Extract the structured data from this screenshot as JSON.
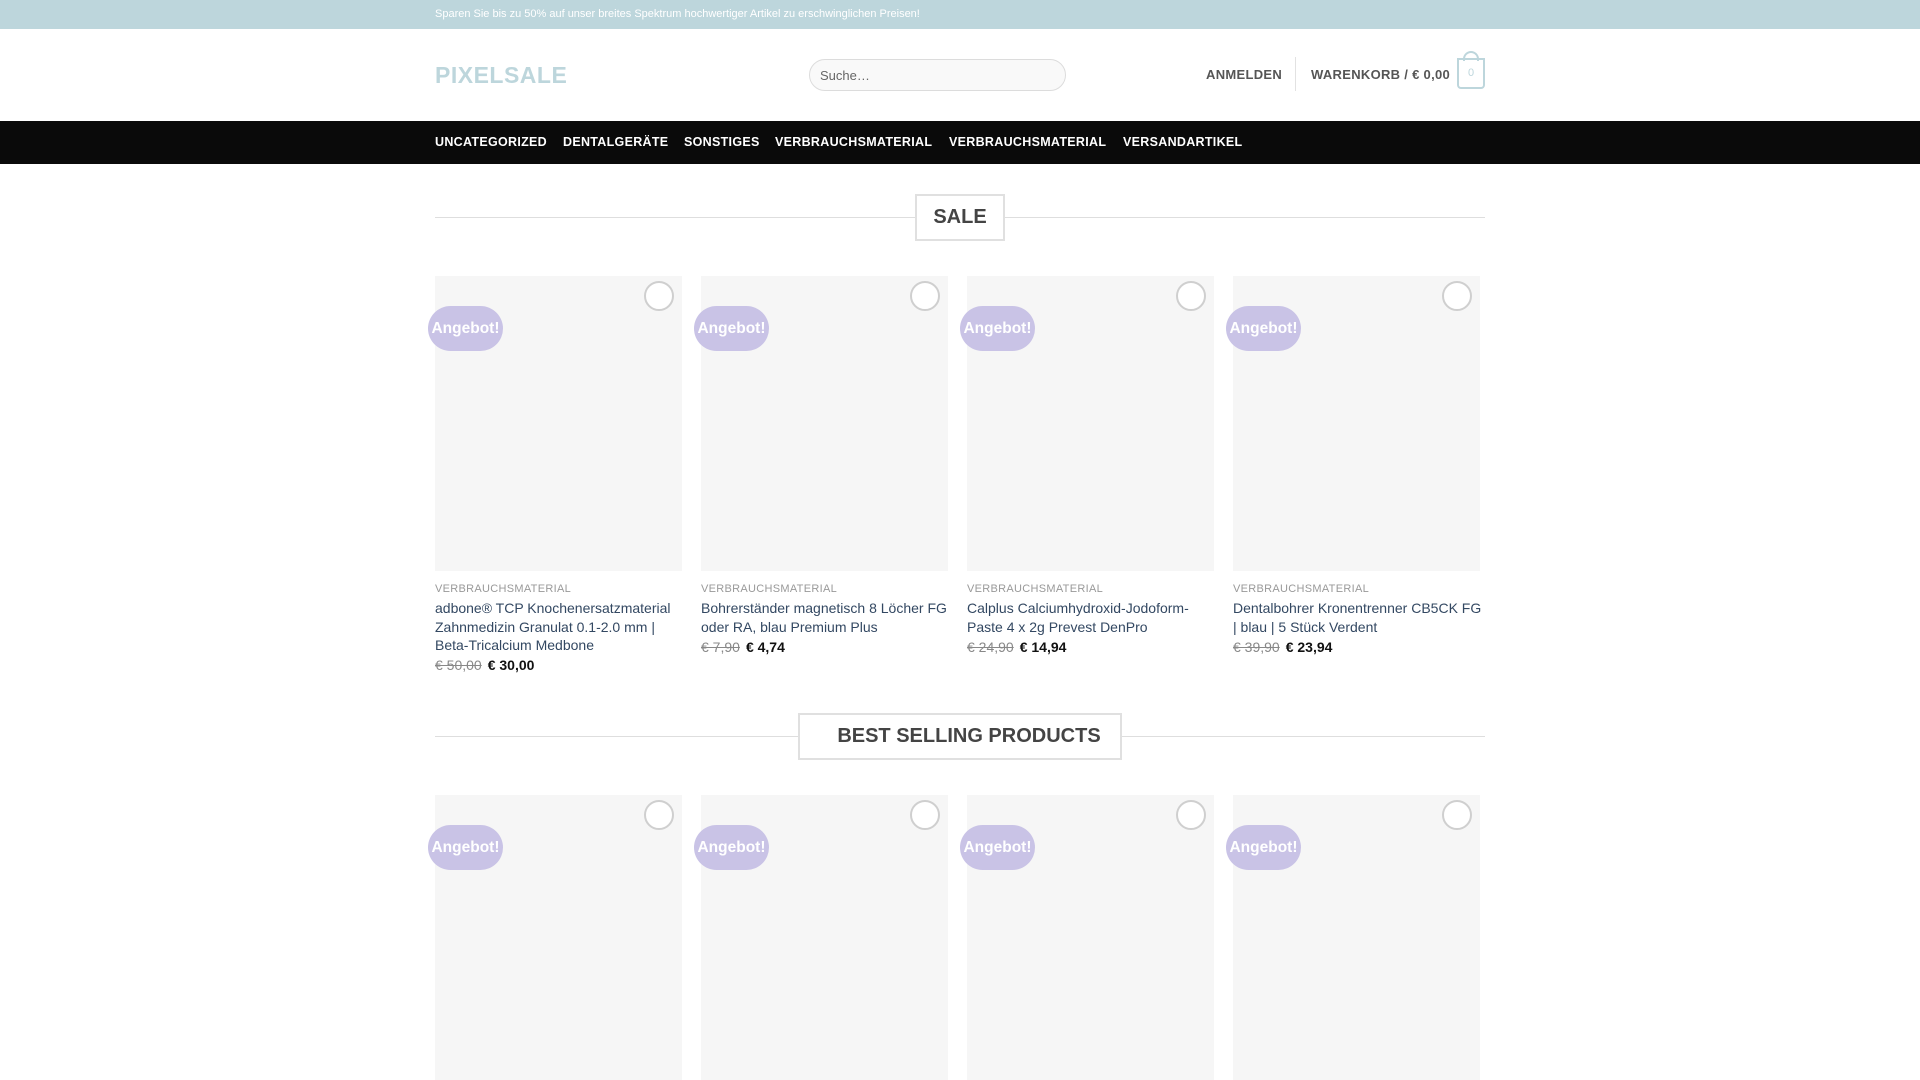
{
  "topbar": {
    "text": "Sparen Sie bis zu 50% auf unser breites Spektrum hochwertiger Artikel zu erschwinglichen Preisen!"
  },
  "header": {
    "logo": "PIXELSALE",
    "search_placeholder": "Suche…",
    "login": "ANMELDEN",
    "cart": "WARENKORB / € 0,00",
    "cart_count": "0"
  },
  "nav": [
    "UNCATEGORIZED",
    "DENTALGERÄTE",
    "SONSTIGES",
    "VERBRAUCHSMATERIAL",
    "VERBRAUCHSMATERIAL",
    "VERSANDARTIKEL"
  ],
  "sections": {
    "sale": {
      "title": "SALE"
    },
    "best": {
      "title": "BEST SELLING PRODUCTS"
    }
  },
  "badge_label": "Angebot!",
  "sale_products": [
    {
      "category": "VERBRAUCHSMATERIAL",
      "title": "adbone® TCP Knochenersatzmaterial Zahnmedizin Granulat 0.1-2.0 mm | Beta-Tricalcium Medbone",
      "old_price": "€ 50,00",
      "price": "€ 30,00"
    },
    {
      "category": "VERBRAUCHSMATERIAL",
      "title": "Bohrerständer magnetisch 8 Löcher FG oder RA, blau Premium Plus",
      "old_price": "€ 7,90",
      "price": "€ 4,74"
    },
    {
      "category": "VERBRAUCHSMATERIAL",
      "title": "Calplus Calciumhydroxid-Jodoform-Paste 4 x 2g Prevest DenPro",
      "old_price": "€ 24,90",
      "price": "€ 14,94"
    },
    {
      "category": "VERBRAUCHSMATERIAL",
      "title": "Dentalbohrer Kronentrenner CB5CK FG | blau | 5 Stück Verdent",
      "old_price": "€ 39,90",
      "price": "€ 23,94"
    }
  ],
  "colors": {
    "accent": "#bdd6dc",
    "nav_bg": "#0a0a0a",
    "badge": "#c9c3e6",
    "title_link": "#334862"
  }
}
